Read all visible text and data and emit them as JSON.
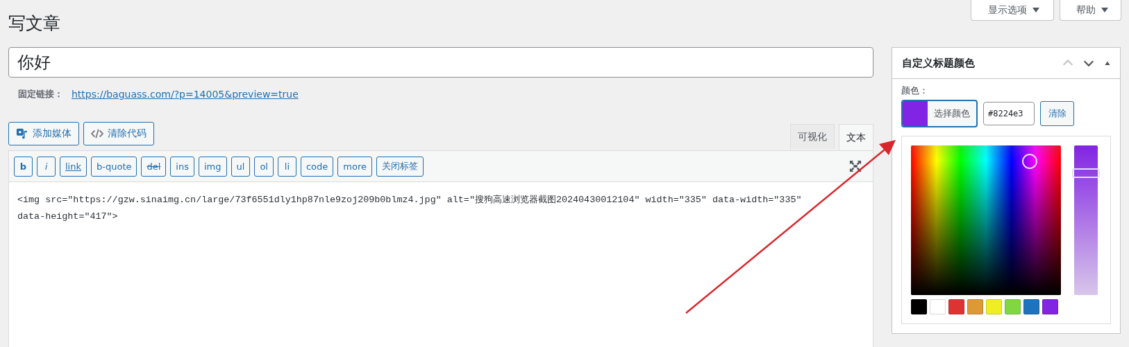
{
  "screen_options": [
    {
      "label": "显示选项"
    },
    {
      "label": "帮助"
    }
  ],
  "page_title": "写文章",
  "post_title": "你好",
  "permalink": {
    "label": "固定链接：",
    "url": "https://baguass.com/?p=14005&preview=true"
  },
  "media_buttons": [
    {
      "kind": "media",
      "label": "添加媒体"
    },
    {
      "kind": "code",
      "label": "清除代码"
    }
  ],
  "editor_tabs": [
    {
      "label": "可视化",
      "selected": false
    },
    {
      "label": "文本",
      "selected": true
    }
  ],
  "quicktags": [
    {
      "label": "b",
      "kind": "bold"
    },
    {
      "label": "i",
      "kind": "italic"
    },
    {
      "label": "link",
      "kind": "link"
    },
    {
      "label": "b-quote",
      "kind": "plain"
    },
    {
      "label": "del",
      "kind": "delete"
    },
    {
      "label": "ins",
      "kind": "plain"
    },
    {
      "label": "img",
      "kind": "plain"
    },
    {
      "label": "ul",
      "kind": "plain"
    },
    {
      "label": "ol",
      "kind": "plain"
    },
    {
      "label": "li",
      "kind": "plain"
    },
    {
      "label": "code",
      "kind": "plain"
    },
    {
      "label": "more",
      "kind": "plain"
    },
    {
      "label": "关闭标签",
      "kind": "plain"
    }
  ],
  "content": "<img src=\"https://gzw.sinaimg.cn/large/73f6551dly1hp87nle9zoj209b0blmz4.jpg\" alt=\"搜狗高速浏览器截图20240430012104\" width=\"335\" data-width=\"335\" data-height=\"417\">",
  "color_box": {
    "title": "自定义标题颜色",
    "label": "颜色：",
    "button_label": "选择颜色",
    "color": "#8224e3",
    "hex": "#8224e3",
    "clear": "清除",
    "shade_slider": {
      "level": 0.82
    },
    "palette": [
      {
        "color": "#000000"
      },
      {
        "color": "#ffffff"
      },
      {
        "color": "#dd3333"
      },
      {
        "color": "#dd9933"
      },
      {
        "color": "#eeee22"
      },
      {
        "color": "#81d742"
      },
      {
        "color": "#1e73be"
      },
      {
        "color": "#8224e3"
      }
    ]
  }
}
